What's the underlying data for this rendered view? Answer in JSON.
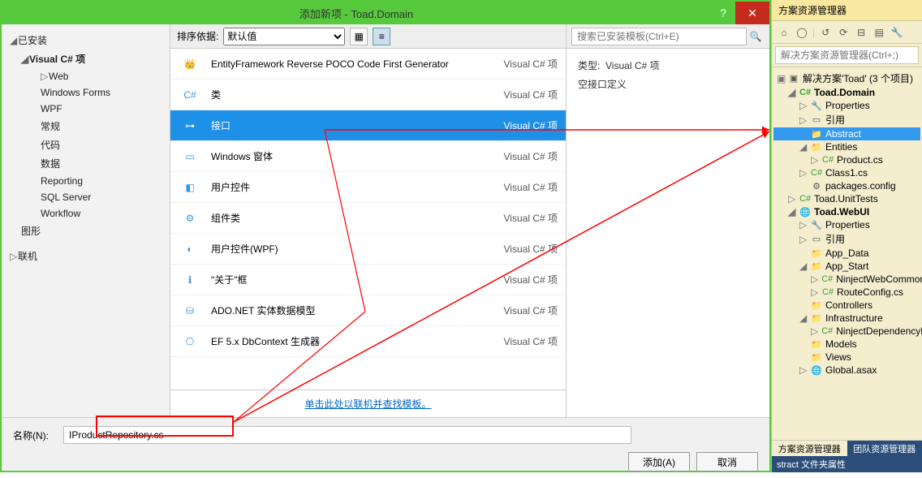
{
  "dialog": {
    "title": "添加新项 - Toad.Domain",
    "sidebar": {
      "installed": "已安装",
      "csharp": "Visual C# 项",
      "children": [
        "Web",
        "Windows Forms",
        "WPF",
        "常规",
        "代码",
        "数据",
        "Reporting",
        "SQL Server",
        "Workflow"
      ],
      "shape": "图形",
      "online": "联机"
    },
    "sort_label": "排序依据:",
    "sort_value": "默认值",
    "items": [
      {
        "label": "EntityFramework Reverse POCO Code First Generator",
        "lang": "Visual C# 项",
        "icon": "crown"
      },
      {
        "label": "类",
        "lang": "Visual C# 项",
        "icon": "class"
      },
      {
        "label": "接口",
        "lang": "Visual C# 项",
        "icon": "interface",
        "selected": true
      },
      {
        "label": "Windows 窗体",
        "lang": "Visual C# 项",
        "icon": "form"
      },
      {
        "label": "用户控件",
        "lang": "Visual C# 项",
        "icon": "ucontrol"
      },
      {
        "label": "组件类",
        "lang": "Visual C# 项",
        "icon": "component"
      },
      {
        "label": "用户控件(WPF)",
        "lang": "Visual C# 项",
        "icon": "wpf"
      },
      {
        "label": "\"关于\"框",
        "lang": "Visual C# 项",
        "icon": "about"
      },
      {
        "label": "ADO.NET 实体数据模型",
        "lang": "Visual C# 项",
        "icon": "ado"
      },
      {
        "label": "EF 5.x DbContext 生成器",
        "lang": "Visual C# 项",
        "icon": "ef"
      }
    ],
    "online_link": "单击此处以联机并查找模板。",
    "search_placeholder": "搜索已安装模板(Ctrl+E)",
    "detail_type_label": "类型:",
    "detail_type_value": "Visual C# 项",
    "detail_desc": "空接口定义",
    "name_label": "名称(N):",
    "name_value": "IProductRepository.cs",
    "add_btn": "添加(A)",
    "cancel_btn": "取消"
  },
  "solution": {
    "title": "方案资源管理器",
    "search_placeholder": "解决方案资源管理器(Ctrl+;)",
    "root": "解决方案'Toad' (3 个项目)",
    "nodes": [
      {
        "lvl": 0,
        "caret": "▣",
        "icon": "sln",
        "label": "解决方案'Toad' (3 个项目)"
      },
      {
        "lvl": 1,
        "caret": "◢",
        "icon": "c#",
        "label": "Toad.Domain",
        "bold": true
      },
      {
        "lvl": 2,
        "caret": "▷",
        "icon": "wrench",
        "label": "Properties"
      },
      {
        "lvl": 2,
        "caret": "▷",
        "icon": "ref",
        "label": "引用"
      },
      {
        "lvl": 2,
        "caret": "",
        "icon": "folder",
        "label": "Abstract",
        "selected": true
      },
      {
        "lvl": 2,
        "caret": "◢",
        "icon": "folder",
        "label": "Entities"
      },
      {
        "lvl": 3,
        "caret": "▷",
        "icon": "cs",
        "label": "Product.cs"
      },
      {
        "lvl": 2,
        "caret": "▷",
        "icon": "cs",
        "label": "Class1.cs"
      },
      {
        "lvl": 2,
        "caret": "",
        "icon": "cfg",
        "label": "packages.config"
      },
      {
        "lvl": 1,
        "caret": "▷",
        "icon": "c#",
        "label": "Toad.UnitTests"
      },
      {
        "lvl": 1,
        "caret": "◢",
        "icon": "web",
        "label": "Toad.WebUI",
        "bold": true
      },
      {
        "lvl": 2,
        "caret": "▷",
        "icon": "wrench",
        "label": "Properties"
      },
      {
        "lvl": 2,
        "caret": "▷",
        "icon": "ref",
        "label": "引用"
      },
      {
        "lvl": 2,
        "caret": "",
        "icon": "folder",
        "label": "App_Data"
      },
      {
        "lvl": 2,
        "caret": "◢",
        "icon": "folder",
        "label": "App_Start"
      },
      {
        "lvl": 3,
        "caret": "▷",
        "icon": "cs",
        "label": "NinjectWebCommon"
      },
      {
        "lvl": 3,
        "caret": "▷",
        "icon": "cs",
        "label": "RouteConfig.cs"
      },
      {
        "lvl": 2,
        "caret": "",
        "icon": "folder",
        "label": "Controllers"
      },
      {
        "lvl": 2,
        "caret": "◢",
        "icon": "folder",
        "label": "Infrastructure"
      },
      {
        "lvl": 3,
        "caret": "▷",
        "icon": "cs",
        "label": "NinjectDependencyR"
      },
      {
        "lvl": 2,
        "caret": "",
        "icon": "folder",
        "label": "Models"
      },
      {
        "lvl": 2,
        "caret": "",
        "icon": "folder",
        "label": "Views"
      },
      {
        "lvl": 2,
        "caret": "▷",
        "icon": "glb",
        "label": "Global.asax"
      }
    ],
    "tab1": "方案资源管理器",
    "tab2": "团队资源管理器",
    "status": "stract 文件夹属性"
  }
}
